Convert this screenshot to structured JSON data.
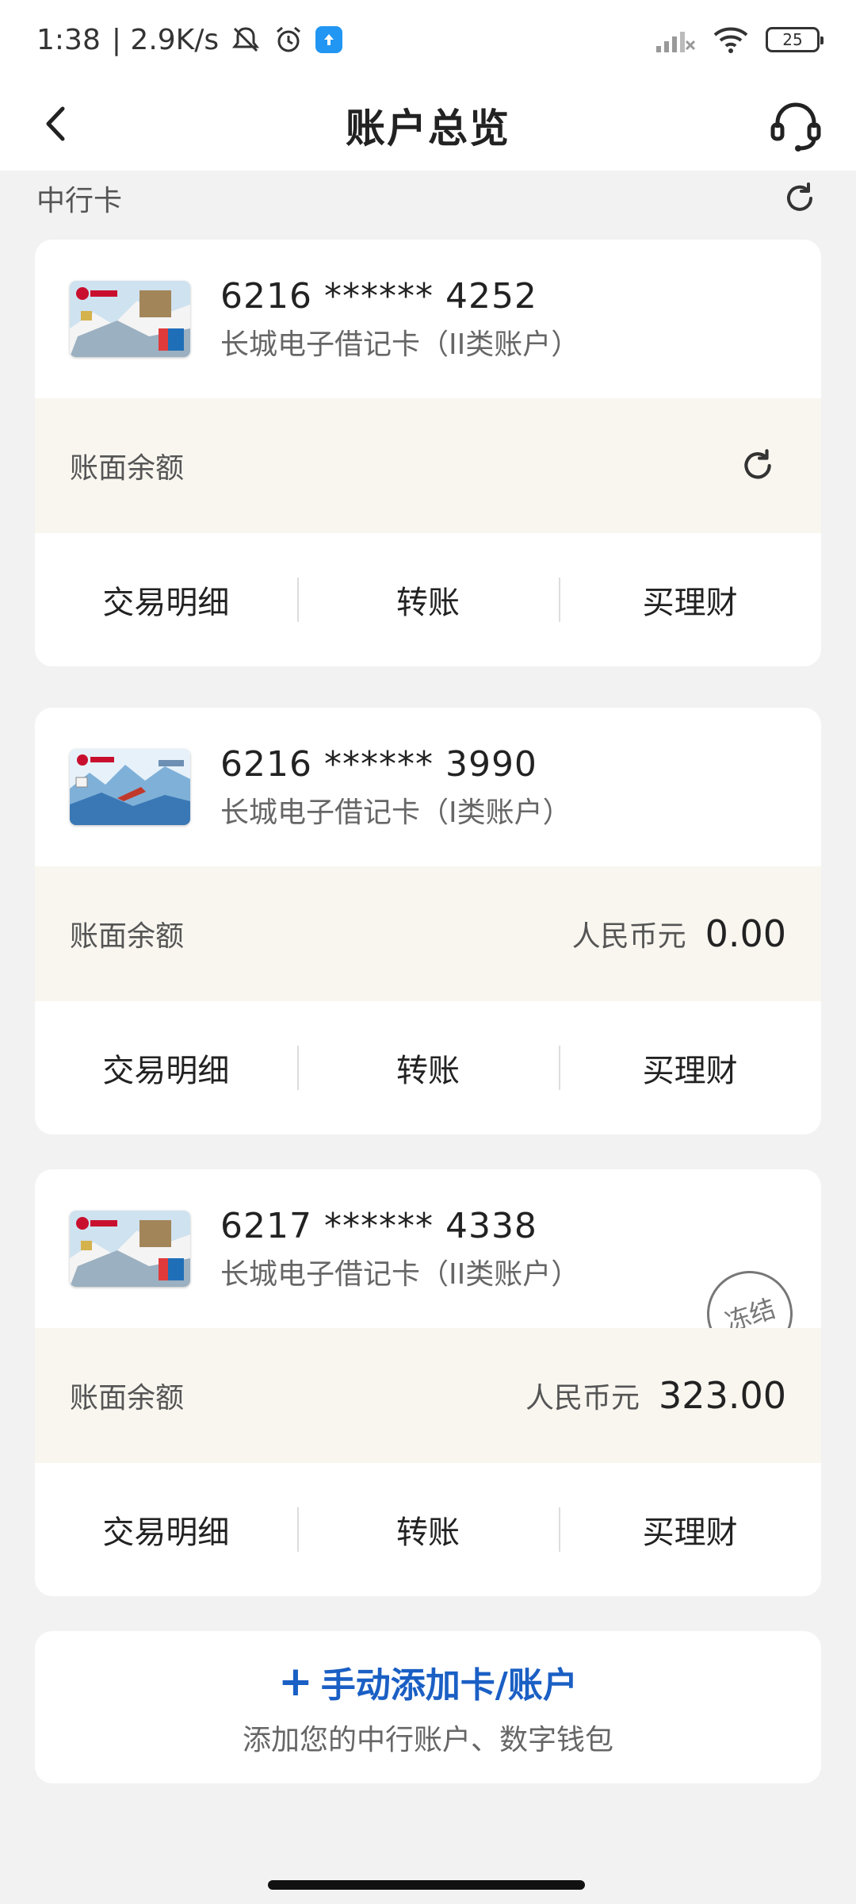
{
  "status_bar": {
    "time": "1:38",
    "network_speed": "| 2.9K/s",
    "battery": "25",
    "icons": [
      "mute-icon",
      "alarm-icon",
      "app-notification-icon",
      "signal-icon",
      "wifi-icon",
      "battery-icon"
    ]
  },
  "nav": {
    "title": "账户总览",
    "back_icon": "back-arrow-icon",
    "service_icon": "customer-service-headset-icon"
  },
  "section": {
    "title": "中行卡"
  },
  "cards": [
    {
      "number": "6216 ****** 4252",
      "type": "长城电子借记卡（II类账户）",
      "balance_label": "账面余额",
      "currency": "",
      "amount": "",
      "actions": [
        "交易明细",
        "转账",
        "买理财"
      ]
    },
    {
      "number": "6216 ****** 3990",
      "type": "长城电子借记卡（I类账户）",
      "balance_label": "账面余额",
      "currency": "人民币元",
      "amount": "0.00",
      "actions": [
        "交易明细",
        "转账",
        "买理财"
      ]
    },
    {
      "number": "6217 ****** 4338",
      "type": "长城电子借记卡（II类账户）",
      "balance_label": "账面余额",
      "currency": "人民币元",
      "amount": "323.00",
      "status_stamp": "冻结",
      "actions": [
        "交易明细",
        "转账",
        "买理财"
      ]
    }
  ],
  "add_account": {
    "plus": "+",
    "title": "手动添加卡/账户",
    "subtitle": "添加您的中行账户、数字钱包"
  },
  "colors": {
    "accent_blue": "#1a5fc4",
    "balance_bg": "#f9f6f0",
    "page_bg": "#f2f2f2"
  }
}
